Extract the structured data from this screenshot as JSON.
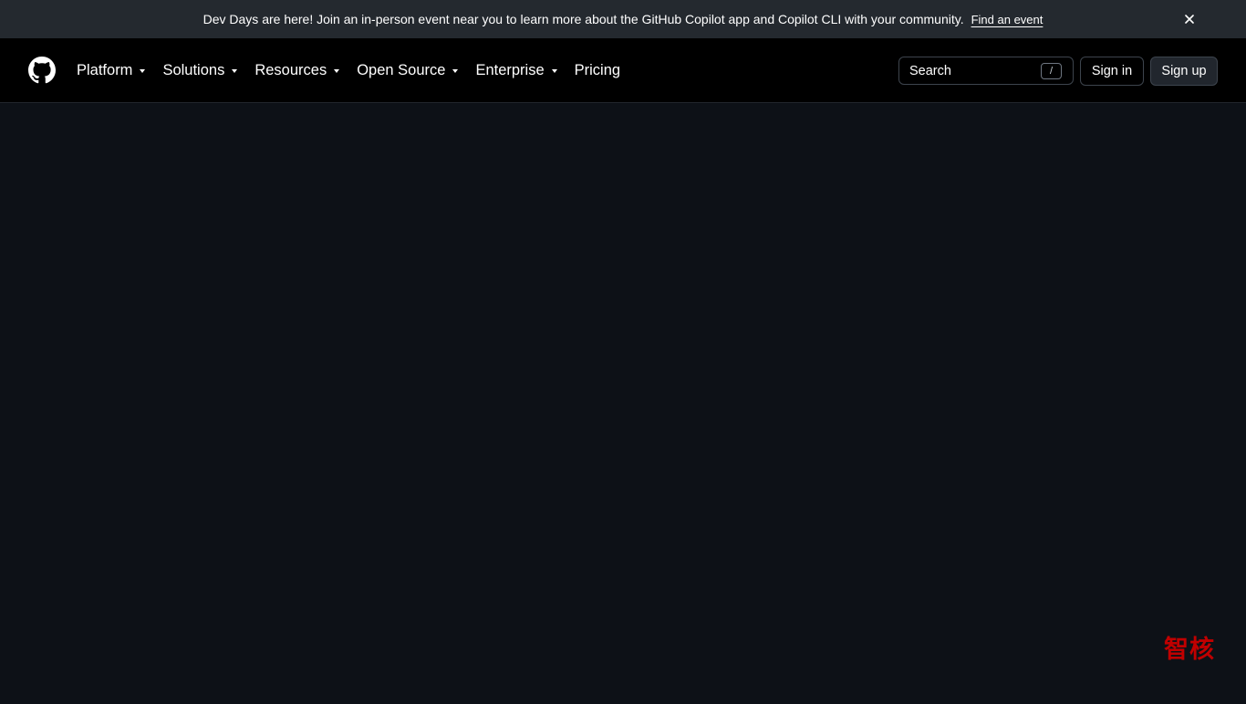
{
  "banner": {
    "text": "Dev Days are here! Join an in-person event near you to learn more about the GitHub Copilot app and Copilot CLI with your community.",
    "link_label": "Find an event",
    "close_icon": "close-icon"
  },
  "header": {
    "logo_icon": "github-mark-icon",
    "nav": [
      {
        "label": "Platform",
        "has_dropdown": true
      },
      {
        "label": "Solutions",
        "has_dropdown": true
      },
      {
        "label": "Resources",
        "has_dropdown": true
      },
      {
        "label": "Open Source",
        "has_dropdown": true
      },
      {
        "label": "Enterprise",
        "has_dropdown": true
      },
      {
        "label": "Pricing",
        "has_dropdown": false
      }
    ],
    "search": {
      "placeholder": "Search",
      "shortcut": "/"
    },
    "sign_in_label": "Sign in",
    "sign_up_label": "Sign up"
  },
  "watermark": {
    "text": "智核"
  },
  "colors": {
    "banner_bg": "#24292f",
    "header_bg": "#000000",
    "page_bg": "#0d1117",
    "watermark": "#c00000"
  }
}
